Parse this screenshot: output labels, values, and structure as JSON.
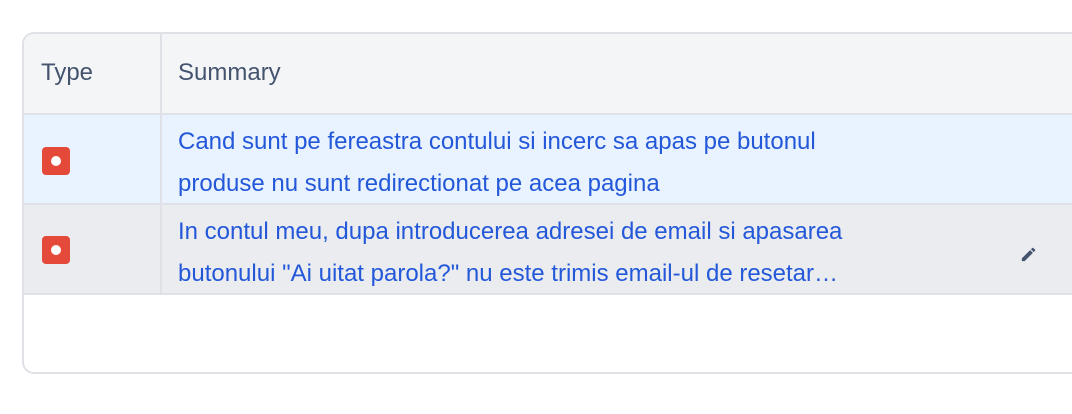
{
  "table": {
    "columns": {
      "type": "Type",
      "summary": "Summary"
    },
    "rows": [
      {
        "type_icon": "bug-icon",
        "summary_line1": "Cand sunt pe fereastra contului si incerc sa apas pe butonul",
        "summary_line2": "produse nu sunt redirectionat pe acea pagina"
      },
      {
        "type_icon": "bug-icon",
        "summary_line1": "In contul meu, dupa introducerea adresei de email si apasarea",
        "summary_line2": "butonului \"Ai uitat parola?\" nu este trimis email-ul de resetar…",
        "action_icon": "edit-pencil-icon"
      }
    ]
  },
  "colors": {
    "link": "#2358d9",
    "bug": "#e5493a",
    "header_bg": "#f4f5f7",
    "selected_row_bg": "#e9f2ff",
    "hover_row_bg": "#ebecf0"
  }
}
